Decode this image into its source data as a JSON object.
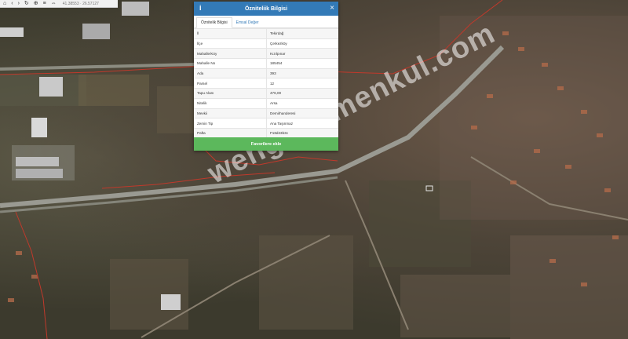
{
  "toolbar": {
    "icons": [
      "home-icon",
      "back-icon",
      "forward-icon",
      "refresh-icon",
      "zoom-icon",
      "layers-icon",
      "ruler-icon",
      "share-icon"
    ],
    "coordinates": "41.38553 · 26.57127"
  },
  "watermark": "wengayrimenkul.com",
  "panel": {
    "title": "Özniteliik Bilgisi",
    "tabs": [
      {
        "label": "Öznitelik Bilgisi",
        "active": true
      },
      {
        "label": "Emsal Değer",
        "active": false
      }
    ],
    "rows": [
      {
        "key": "İl",
        "value": "Tekirdağ"
      },
      {
        "key": "İlçe",
        "value": "Çerkezköy"
      },
      {
        "key": "Mahalle/Köy",
        "value": "Kızılpınar"
      },
      {
        "key": "Mahalle No",
        "value": "185454"
      },
      {
        "key": "Ada",
        "value": "393"
      },
      {
        "key": "Parsel",
        "value": "12"
      },
      {
        "key": "Tapu Alanı",
        "value": "476,00"
      },
      {
        "key": "Nitelik",
        "value": "Arsa"
      },
      {
        "key": "Mevkii",
        "value": "Demirhanderesi"
      },
      {
        "key": "Zemin Tip",
        "value": "Ana Taşınmaz"
      },
      {
        "key": "Pafta",
        "value": "F18d23b3c"
      }
    ],
    "favorite_button": "Favorilere ekle"
  },
  "colors": {
    "header": "#337ab7",
    "button": "#5cb85c",
    "boundary": "#c0392b"
  }
}
